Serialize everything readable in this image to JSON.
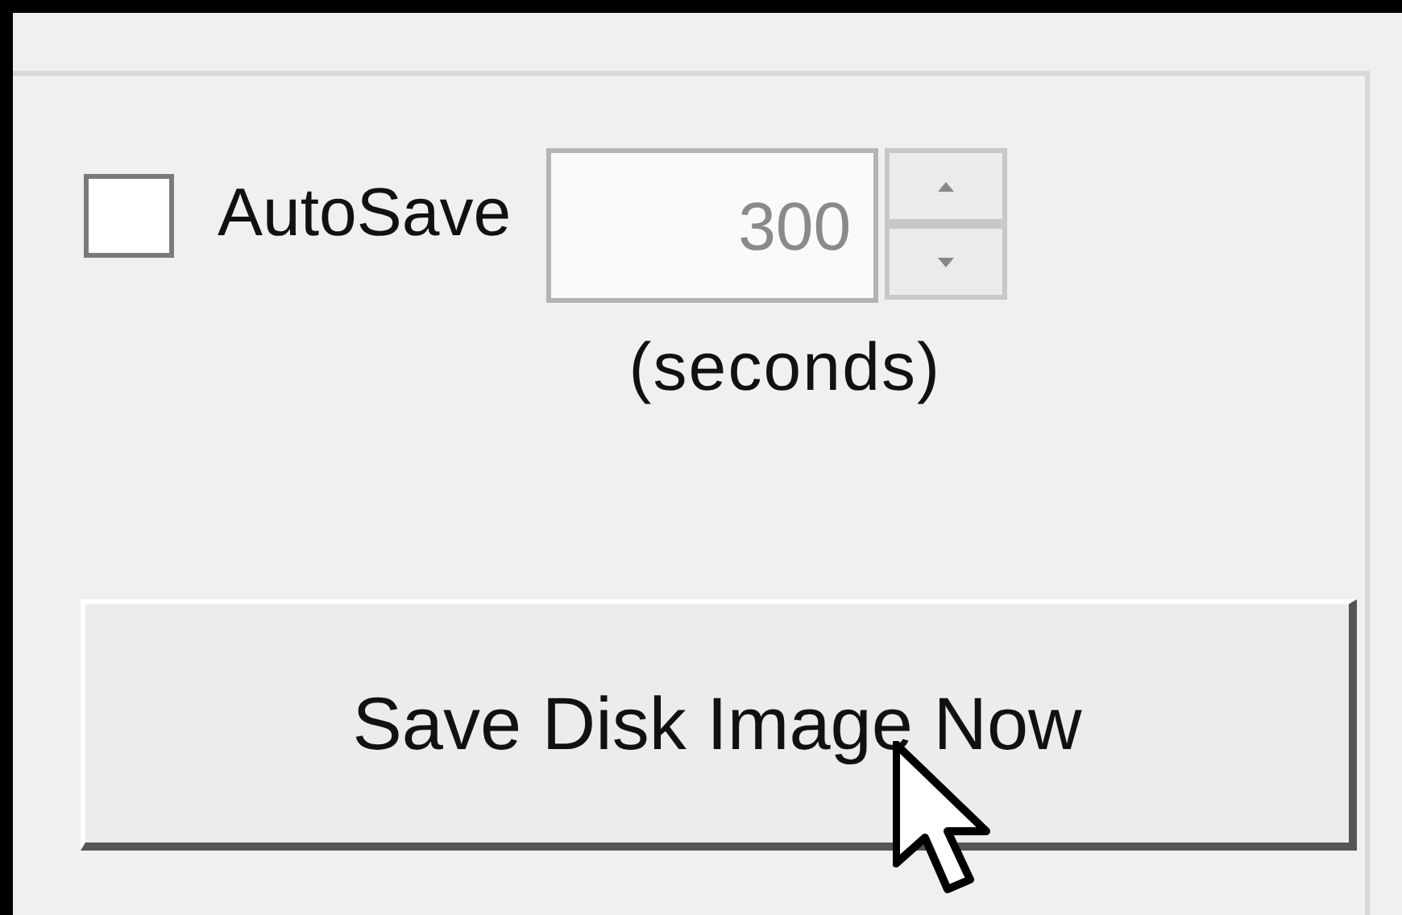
{
  "autosave": {
    "label": "AutoSave",
    "checked": false
  },
  "interval": {
    "value": "300",
    "disabled": true,
    "unit": "(seconds)"
  },
  "save_button": {
    "label": "Save Disk Image Now"
  }
}
